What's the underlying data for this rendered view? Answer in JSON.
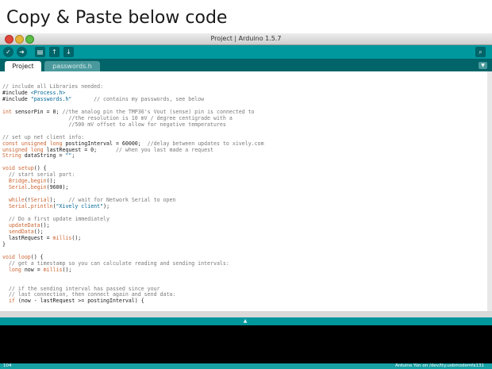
{
  "slide": {
    "title": "Copy & Paste below code"
  },
  "window": {
    "title": "Project | Arduino 1.5.7"
  },
  "toolbar": {
    "verify_icon": "check-icon",
    "upload_icon": "arrow-right-icon",
    "new_icon": "new-file-icon",
    "open_icon": "open-up-arrow-icon",
    "save_icon": "save-down-arrow-icon",
    "monitor_icon": "serial-monitor-magnifier-icon"
  },
  "tabs": [
    {
      "label": "Project"
    },
    {
      "label": "passwords.h"
    }
  ],
  "code_lines": [
    "// include all Libraries needed:",
    "#include <Process.h>",
    "#include \"passwords.h\"       // contains my passwords, see below",
    "",
    "int sensorPin = 0; //the analog pin the TMP36's Vout (sense) pin is connected to",
    "                     //the resolution is 10 mV / degree centigrade with a",
    "                     //500 mV offset to allow for negative temperatures",
    "",
    "// set up net client info:",
    "const unsigned long postingInterval = 60000;  //delay between updates to xively.com",
    "unsigned long lastRequest = 0;      // when you last made a request",
    "String dataString = \"\";",
    "",
    "void setup() {",
    "  // start serial port:",
    "  Bridge.begin();",
    "  Serial.begin(9600);",
    "",
    "  while(!Serial);    // wait for Network Serial to open",
    "  Serial.println(\"Xively client\");",
    "",
    "  // Do a first update immediately",
    "  updateData();",
    "  sendData();",
    "  lastRequest = millis();",
    "}",
    "",
    "void loop() {",
    "  // get a timestamp so you can calculate reading and sending intervals:",
    "  long now = millis();",
    "",
    "",
    "  // if the sending interval has passed since your",
    "  // last connection, then connect again and send data:",
    "  if (now - lastRequest >= postingInterval) {"
  ],
  "status": {
    "line_number": "104",
    "board": "Arduino Yún on /dev/tty.usbmodemfa131"
  },
  "colors": {
    "toolbar": "#00979d",
    "tabbar": "#006468",
    "keyword": "#cc6633",
    "string": "#006699",
    "comment": "#7a7a7a"
  }
}
